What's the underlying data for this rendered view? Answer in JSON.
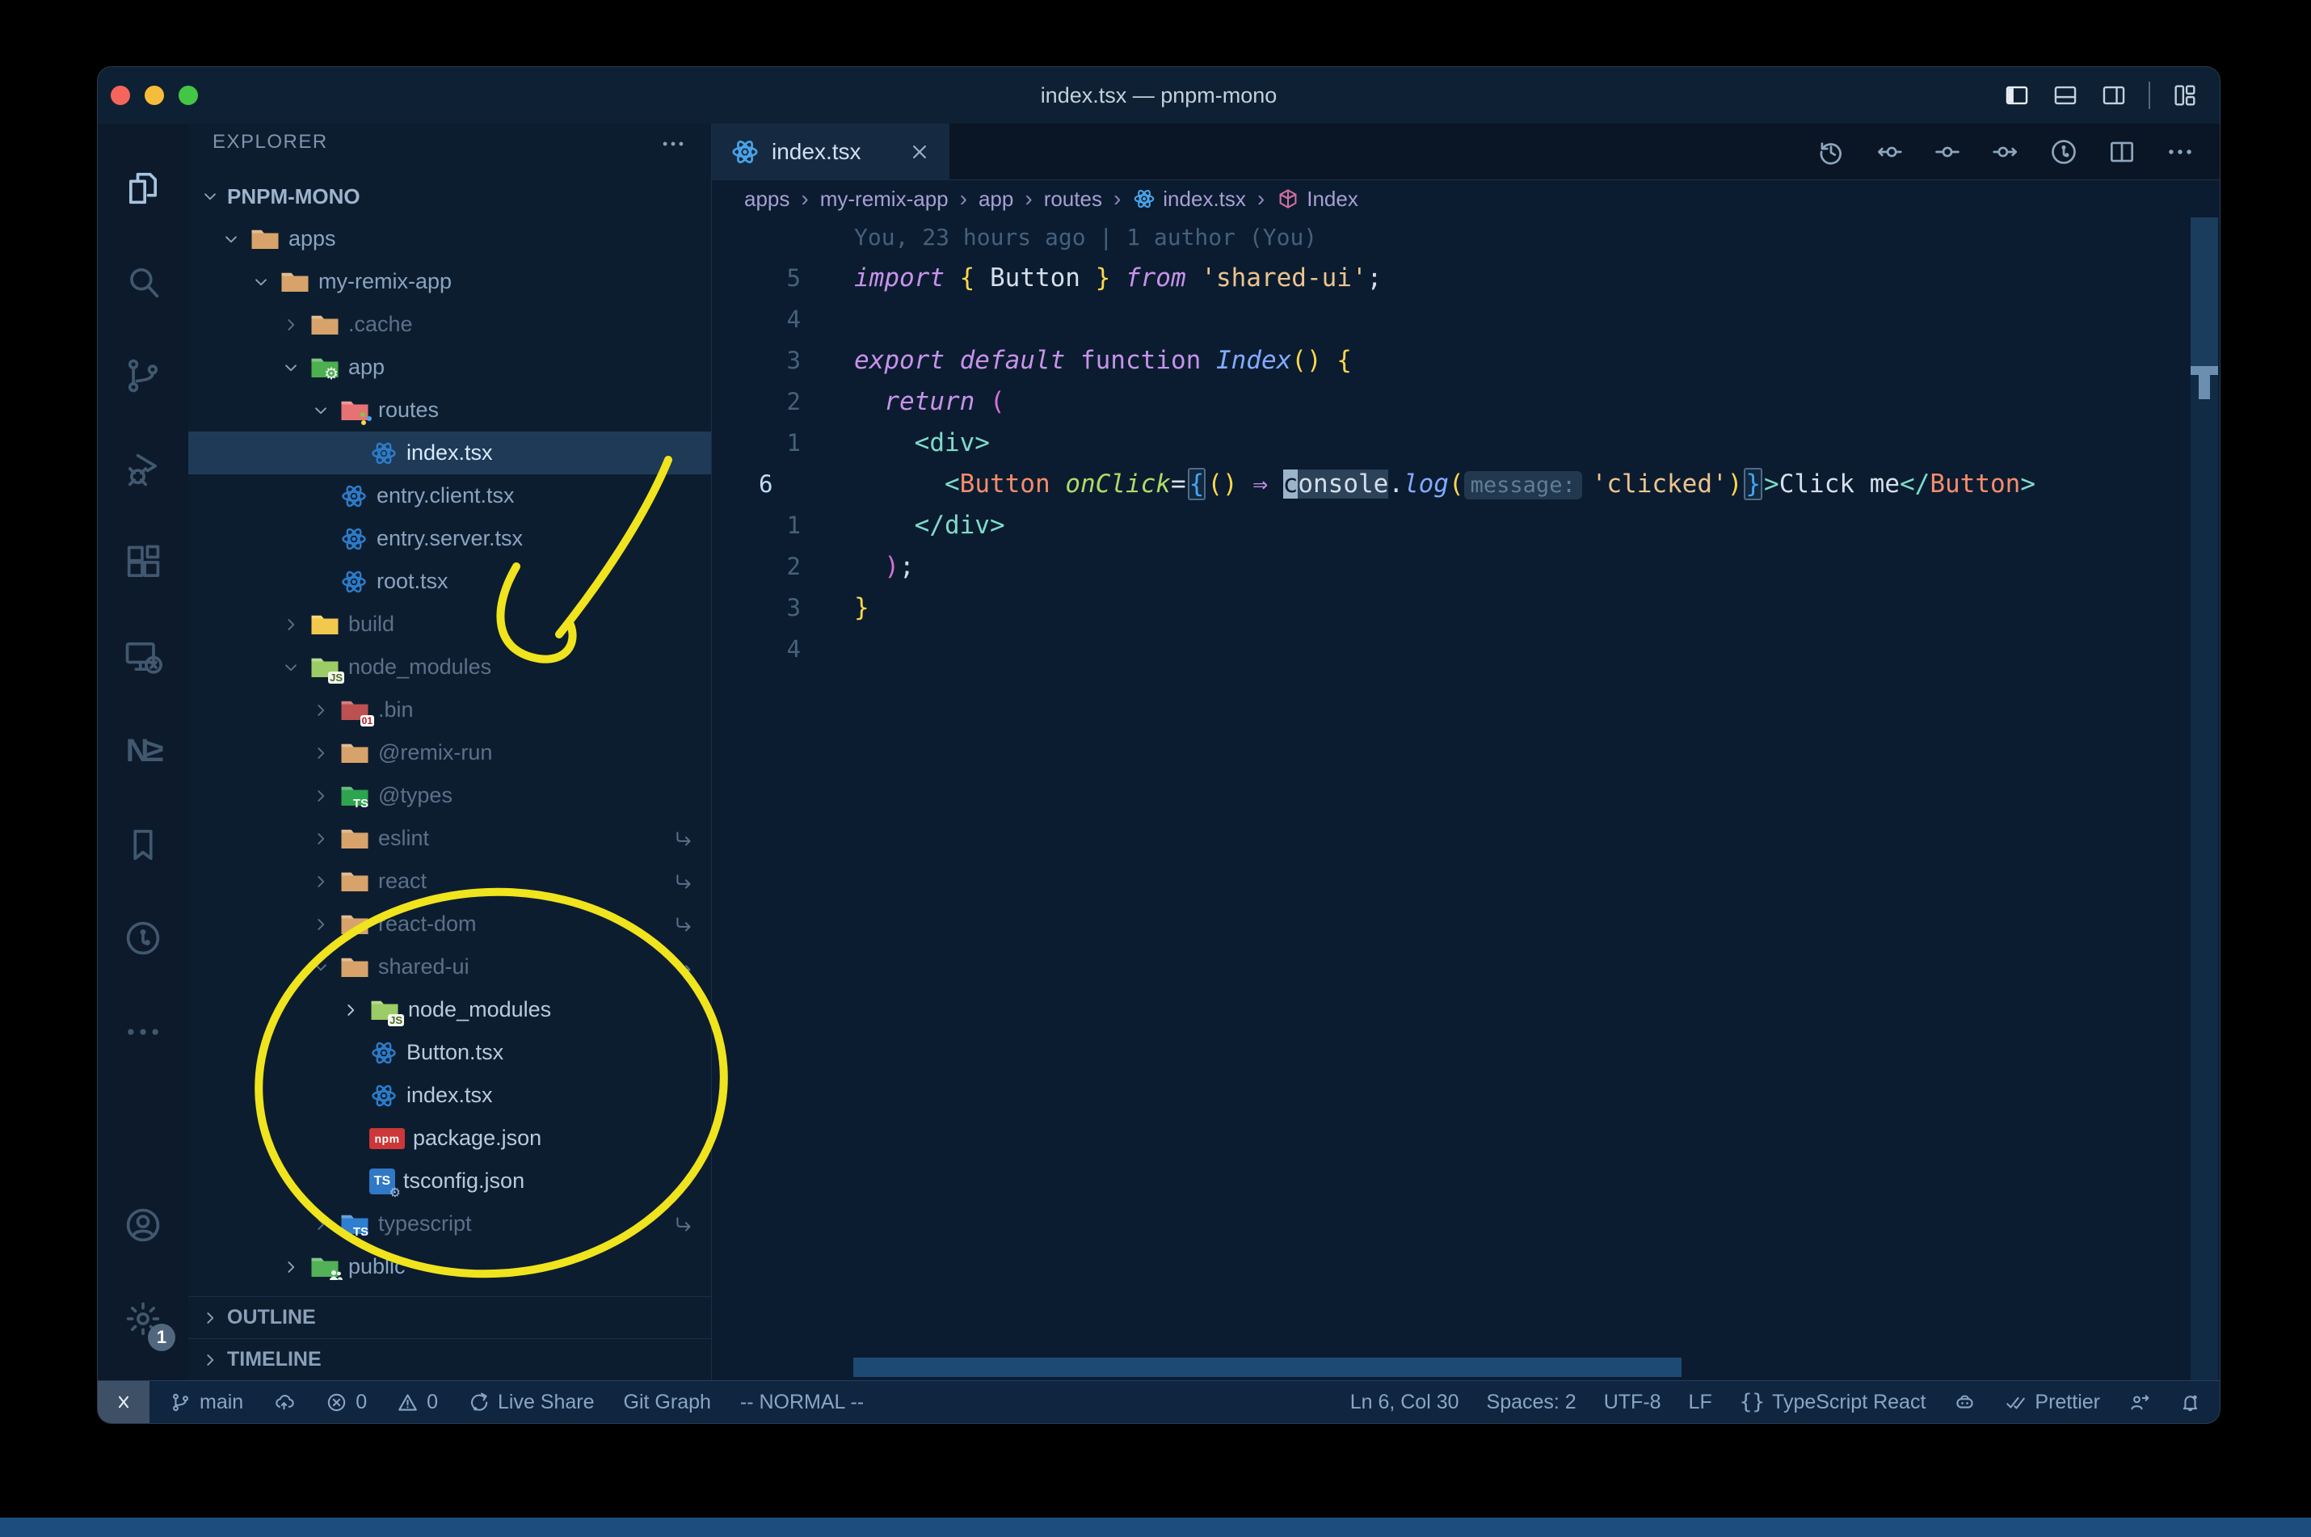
{
  "window": {
    "title": "index.tsx — pnpm-mono",
    "controls": [
      "close",
      "minimize",
      "zoom"
    ]
  },
  "title_bar": {
    "icons": [
      {
        "icon": "layout-left",
        "name": "toggle-primary-sidebar",
        "active": true
      },
      {
        "icon": "layout-bottom",
        "name": "toggle-panel"
      },
      {
        "icon": "layout-right",
        "name": "toggle-secondary-sidebar",
        "sep_after": true
      },
      {
        "icon": "layout-grid",
        "name": "customize-layout"
      }
    ]
  },
  "activity_bar": {
    "top": [
      {
        "icon": "files",
        "name": "explorer",
        "active": true
      },
      {
        "icon": "search",
        "name": "search"
      },
      {
        "icon": "source-control",
        "name": "source-control"
      },
      {
        "icon": "debug",
        "name": "run-and-debug"
      },
      {
        "icon": "extensions",
        "name": "extensions"
      },
      {
        "icon": "remote-explorer",
        "name": "remote-explorer"
      },
      {
        "icon": "nx",
        "name": "nx-console",
        "text": "N≥"
      },
      {
        "icon": "bookmark",
        "name": "bookmarks"
      },
      {
        "icon": "gitlens",
        "name": "gitlens"
      },
      {
        "icon": "more",
        "name": "additional-views"
      }
    ],
    "bottom": [
      {
        "icon": "account",
        "name": "accounts"
      },
      {
        "icon": "settings",
        "name": "manage",
        "badge": "1"
      }
    ]
  },
  "explorer": {
    "header": "EXPLORER",
    "project": "PNPM-MONO",
    "tree": [
      {
        "l": "apps",
        "d": 0,
        "ch": "v",
        "ic": "folder",
        "fc": "#d7a36a"
      },
      {
        "l": "my-remix-app",
        "d": 1,
        "ch": "v",
        "ic": "folder",
        "fc": "#d7a36a"
      },
      {
        "l": ".cache",
        "d": 2,
        "ch": ">",
        "ic": "folder",
        "fc": "#d7a36a",
        "cls": "dim"
      },
      {
        "l": "app",
        "d": 2,
        "ch": "v",
        "ic": "folder",
        "fc": "#4caf50",
        "b": "gear"
      },
      {
        "l": "routes",
        "d": 3,
        "ch": "v",
        "ic": "folder",
        "fc": "#e57373",
        "b": "dots"
      },
      {
        "l": "index.tsx",
        "d": 4,
        "ch": "",
        "ic": "react",
        "cls": "sel"
      },
      {
        "l": "entry.client.tsx",
        "d": 3,
        "ch": "",
        "ic": "react"
      },
      {
        "l": "entry.server.tsx",
        "d": 3,
        "ch": "",
        "ic": "react"
      },
      {
        "l": "root.tsx",
        "d": 3,
        "ch": "",
        "ic": "react"
      },
      {
        "l": "build",
        "d": 2,
        "ch": ">",
        "ic": "folder",
        "fc": "#f2c94c",
        "cls": "dim"
      },
      {
        "l": "node_modules",
        "d": 2,
        "ch": "v",
        "ic": "folder",
        "fc": "#9ccc65",
        "b": "JS",
        "cls": "dim"
      },
      {
        "l": ".bin",
        "d": 3,
        "ch": ">",
        "ic": "folder",
        "fc": "#bd5151",
        "b": "01",
        "cls": "dim"
      },
      {
        "l": "@remix-run",
        "d": 3,
        "ch": ">",
        "ic": "folder",
        "fc": "#d7a36a",
        "cls": "dim"
      },
      {
        "l": "@types",
        "d": 3,
        "ch": ">",
        "ic": "folder",
        "fc": "#2ea44f",
        "b": "TS",
        "cls": "dim"
      },
      {
        "l": "eslint",
        "d": 3,
        "ch": ">",
        "ic": "folder",
        "fc": "#d7a36a",
        "cls": "dim",
        "sym": true
      },
      {
        "l": "react",
        "d": 3,
        "ch": ">",
        "ic": "folder",
        "fc": "#d7a36a",
        "cls": "dim",
        "sym": true
      },
      {
        "l": "react-dom",
        "d": 3,
        "ch": ">",
        "ic": "folder",
        "fc": "#d7a36a",
        "cls": "dim",
        "sym": true
      },
      {
        "l": "shared-ui",
        "d": 3,
        "ch": "v",
        "ic": "folder",
        "fc": "#d7a36a",
        "cls": "dim",
        "sym": true
      },
      {
        "l": "node_modules",
        "d": 4,
        "ch": ">",
        "ic": "folder",
        "fc": "#9ccc65",
        "b": "JS",
        "cls": "bright"
      },
      {
        "l": "Button.tsx",
        "d": 4,
        "ch": "",
        "ic": "react",
        "cls": "bright"
      },
      {
        "l": "index.tsx",
        "d": 4,
        "ch": "",
        "ic": "react",
        "cls": "bright"
      },
      {
        "l": "package.json",
        "d": 4,
        "ch": "",
        "ic": "npm",
        "cls": "bright"
      },
      {
        "l": "tsconfig.json",
        "d": 4,
        "ch": "",
        "ic": "tsfile",
        "cls": "bright"
      },
      {
        "l": "typescript",
        "d": 3,
        "ch": ">",
        "ic": "folder",
        "fc": "#2f7fd0",
        "b": "TS",
        "cls": "dim",
        "sym": true
      },
      {
        "l": "public",
        "d": 2,
        "ch": ">",
        "ic": "folder",
        "fc": "#53b158",
        "b": "people"
      }
    ],
    "bottom_sections": [
      {
        "label": "OUTLINE"
      },
      {
        "label": "TIMELINE"
      }
    ]
  },
  "editor": {
    "tab": {
      "label": "index.tsx"
    },
    "actions": [
      {
        "icon": "history",
        "name": "timeline-history"
      },
      {
        "icon": "prev-change",
        "name": "previous-change"
      },
      {
        "icon": "node-change",
        "name": "change-node"
      },
      {
        "icon": "next-change",
        "name": "next-change"
      },
      {
        "icon": "gitlens",
        "name": "gitlens-graph"
      },
      {
        "icon": "split",
        "name": "split-editor"
      },
      {
        "icon": "more",
        "name": "more-actions"
      }
    ],
    "breadcrumbs": {
      "separator": "›",
      "items": [
        {
          "label": "apps"
        },
        {
          "label": "my-remix-app"
        },
        {
          "label": "app"
        },
        {
          "label": "routes"
        },
        {
          "label": "index.tsx",
          "icon": "react"
        },
        {
          "label": "Index",
          "icon": "cube"
        }
      ]
    },
    "blame": "You, 23 hours ago | 1 author (You)",
    "lines": [
      {
        "n": "5",
        "t": [
          [
            "import ",
            "kwI"
          ],
          [
            "{",
            "gold"
          ],
          [
            " Button ",
            "w"
          ],
          [
            "}",
            "gold"
          ],
          [
            " ",
            "w"
          ],
          [
            "from",
            "kwI"
          ],
          [
            " ",
            "w"
          ],
          [
            "'shared-ui'",
            "str"
          ],
          [
            ";",
            "w"
          ]
        ]
      },
      {
        "n": "4",
        "t": []
      },
      {
        "n": "3",
        "t": [
          [
            "export default ",
            "kwI"
          ],
          [
            "function ",
            "kw"
          ],
          [
            "Index",
            "fnI"
          ],
          [
            "() {",
            "gold"
          ]
        ]
      },
      {
        "n": "2",
        "t": [
          [
            "  ",
            "w"
          ],
          [
            "return ",
            "kwI"
          ],
          [
            "(",
            "orchid"
          ]
        ]
      },
      {
        "n": "1",
        "t": [
          [
            "    <div>",
            "teal"
          ]
        ]
      },
      {
        "n": "6",
        "a": true,
        "t": [
          [
            "      ",
            "w"
          ],
          [
            "<",
            "teal"
          ],
          [
            "Button",
            "salmon"
          ],
          [
            " ",
            "w"
          ],
          [
            "onClick",
            "attrI"
          ],
          [
            "=",
            "w"
          ],
          [
            "{",
            "blueBox"
          ],
          [
            "()",
            "gold"
          ],
          [
            " ",
            "w"
          ],
          [
            "⇒",
            "kw"
          ],
          [
            " ",
            "w"
          ],
          [
            "c",
            "cursor"
          ],
          [
            "onsole",
            "wHl"
          ],
          [
            ".",
            "w"
          ],
          [
            "log",
            "fnI"
          ],
          [
            "(",
            "gold"
          ],
          [
            "message:",
            "inlay"
          ],
          [
            "'clicked'",
            "str"
          ],
          [
            ")",
            "gold"
          ],
          [
            "}",
            "blueBox"
          ],
          [
            ">",
            "teal"
          ],
          [
            "Click me",
            "w"
          ],
          [
            "</",
            "teal"
          ],
          [
            "Button",
            "salmon"
          ],
          [
            ">",
            "teal"
          ]
        ]
      },
      {
        "n": "1",
        "t": [
          [
            "    </div>",
            "teal"
          ]
        ]
      },
      {
        "n": "2",
        "t": [
          [
            "  ",
            "w"
          ],
          [
            ")",
            "orchid"
          ],
          [
            ";",
            "w"
          ]
        ]
      },
      {
        "n": "3",
        "t": [
          [
            "}",
            "gold"
          ]
        ]
      },
      {
        "n": "4",
        "t": []
      }
    ]
  },
  "status_bar": {
    "left": [
      {
        "icon": "remote",
        "name": "remote-indicator",
        "tile": true
      },
      {
        "icon": "branch",
        "label": "main",
        "name": "git-branch"
      },
      {
        "icon": "cloud-up",
        "name": "publish-changes"
      },
      {
        "icon": "error",
        "label": "0",
        "name": "errors"
      },
      {
        "icon": "warning",
        "label": "0",
        "name": "warnings"
      },
      {
        "icon": "live-share",
        "label": "Live Share",
        "name": "live-share"
      },
      {
        "label": "Git Graph",
        "name": "git-graph"
      },
      {
        "label": "-- NORMAL --",
        "name": "vim-mode"
      }
    ],
    "right": [
      {
        "label": "Ln 6, Col 30",
        "name": "cursor-position"
      },
      {
        "label": "Spaces: 2",
        "name": "indentation"
      },
      {
        "label": "UTF-8",
        "name": "encoding"
      },
      {
        "label": "LF",
        "name": "eol"
      },
      {
        "icon": "braces",
        "label": "TypeScript React",
        "name": "language-mode"
      },
      {
        "icon": "copilot",
        "name": "copilot"
      },
      {
        "icon": "double-check",
        "label": "Prettier",
        "name": "prettier"
      },
      {
        "icon": "person-feedback",
        "name": "feedback"
      },
      {
        "icon": "bell-dot",
        "name": "notifications"
      }
    ]
  },
  "annotations": {
    "color": "#efe41d"
  }
}
